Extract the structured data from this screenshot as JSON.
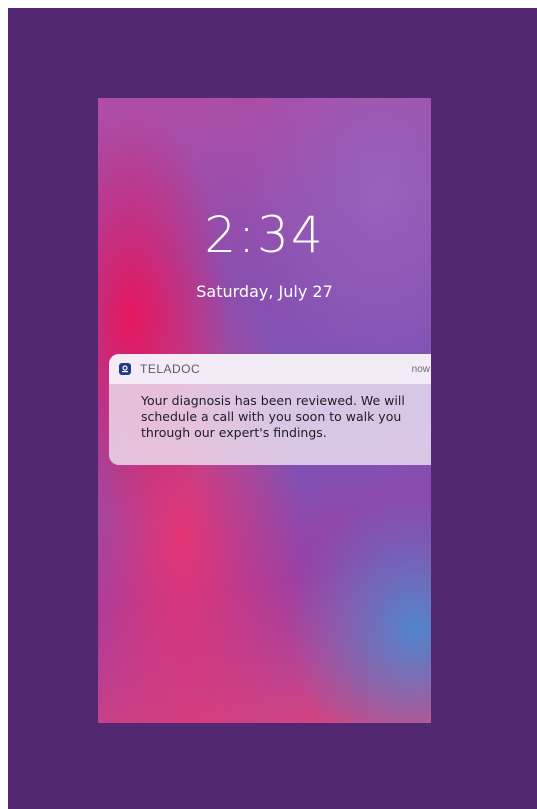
{
  "lockscreen": {
    "time": "2:34",
    "date": "Saturday, July 27"
  },
  "notification": {
    "app_name": "TELADOC",
    "app_icon": "teladoc-logo-icon",
    "timestamp": "now",
    "message": "Your diagnosis has been reviewed. We will schedule a call with you soon to walk you through our expert's findings."
  },
  "colors": {
    "frame_background": "#522873",
    "app_icon": "#1f3a8a"
  }
}
